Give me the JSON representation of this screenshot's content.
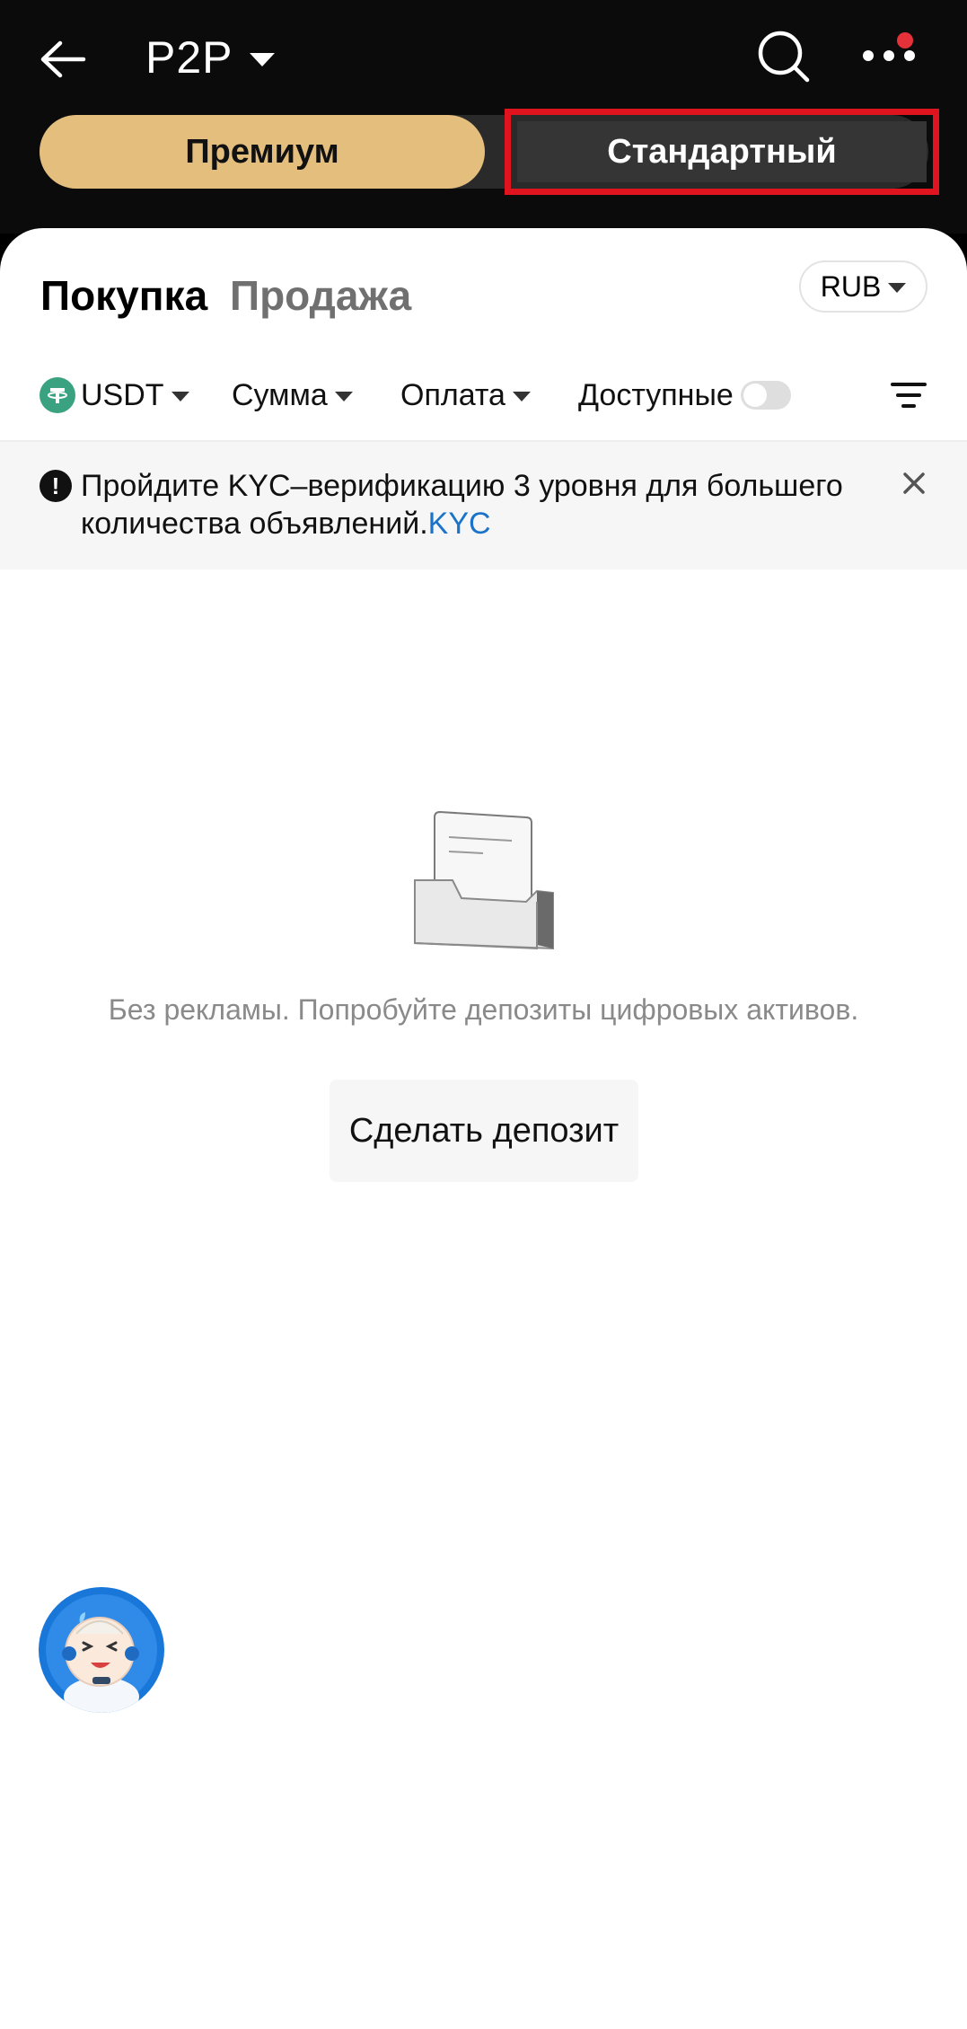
{
  "header": {
    "title": "P2P",
    "back_icon": "arrow-left-icon",
    "search_icon": "search-icon",
    "more_icon": "more-dots-icon",
    "notification_dot_color": "#e5323a"
  },
  "segment": {
    "premium_label": "Премиум",
    "standard_label": "Стандартный",
    "premium_color": "#e3be7d",
    "highlight_color": "#e0141e"
  },
  "trade_tabs": {
    "buy_label": "Покупка",
    "sell_label": "Продажа"
  },
  "currency": {
    "selected": "RUB"
  },
  "filters": {
    "asset": "USDT",
    "amount": "Сумма",
    "payment": "Оплата",
    "available": "Доступные",
    "available_toggle_on": false
  },
  "notice": {
    "text": "Пройдите KYC–верификацию 3 уровня для большего количества объявлений.",
    "link": "KYC"
  },
  "empty_state": {
    "message": "Без рекламы. Попробуйте депозиты цифровых активов.",
    "button_label": "Сделать депозит"
  }
}
